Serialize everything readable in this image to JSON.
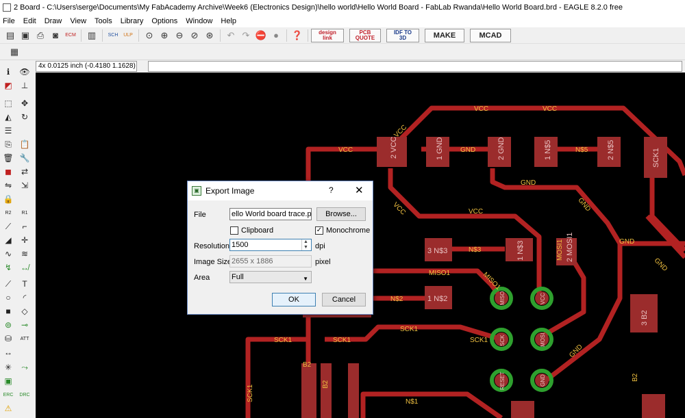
{
  "window": {
    "title": "2 Board - C:\\Users\\serge\\Documents\\My FabAcademy Archive\\Week6 (Electronics Design)\\hello world\\Hello World Board - FabLab Rwanda\\Hello World Board.brd - EAGLE 8.2.0 free"
  },
  "menu": [
    "File",
    "Edit",
    "Draw",
    "View",
    "Tools",
    "Library",
    "Options",
    "Window",
    "Help"
  ],
  "toolbar": {
    "badges": {
      "design_link": "design link",
      "pcb_quote": "PCB QUOTE",
      "idf": "IDF TO 3D",
      "make": "MAKE",
      "mcad": "MCAD"
    },
    "icons": [
      "open-icon",
      "save-icon",
      "print-icon",
      "cam-icon",
      "ecm-icon",
      "lib-icon",
      "sch-icon",
      "ulp-icon",
      "zoom-fit-icon",
      "zoom-in-icon",
      "zoom-out-icon",
      "zoom-select-icon",
      "zoom-area-icon",
      "undo-icon",
      "redo-icon",
      "stop-icon",
      "go-icon",
      "help-icon"
    ]
  },
  "coord": {
    "display": "4x 0.0125 inch (-0.4180 1.1628)"
  },
  "dialog": {
    "title": "Export Image",
    "help": "?",
    "close": "✕",
    "file_label": "File",
    "file_value": "ello World board trace.png",
    "browse_label": "Browse...",
    "clipboard_label": "Clipboard",
    "clipboard_checked": false,
    "monochrome_label": "Monochrome",
    "monochrome_checked": true,
    "resolution_label": "Resolution",
    "resolution_value": "1500",
    "dpi_label": "dpi",
    "image_size_label": "Image Size",
    "image_size_value": "2655 x 1886",
    "pixel_label": "pixel",
    "area_label": "Area",
    "area_value": "Full",
    "ok_label": "OK",
    "cancel_label": "Cancel"
  },
  "board": {
    "trace_color": "#b22222",
    "pad_color": "#9b2c2c",
    "via_color": "#2ea02e",
    "label_color": "#f0c040",
    "net_labels": [
      "VCC",
      "VCC",
      "VCC",
      "VCC",
      "VCC",
      "VCC",
      "GND",
      "GND",
      "GND",
      "GND",
      "GND",
      "GND",
      "N$5",
      "N$3",
      "N$2",
      "N$1",
      "MISO1",
      "MISO1",
      "MOSI1",
      "SCK1",
      "SCK1",
      "SCK1",
      "SCK1",
      "SCK1",
      "B2",
      "B2",
      "B2"
    ],
    "pad_labels": [
      "2 VCC",
      "1 GND",
      "2 GND",
      "1 N$5",
      "2 N$5",
      "SCK1",
      "3 N$3",
      "1 N$3",
      "2 MOSI1",
      "3 B2",
      "1 N$2"
    ],
    "via_labels": [
      "MISO",
      "VCC",
      "SCK",
      "MOSI",
      "RESET",
      "GND"
    ]
  }
}
